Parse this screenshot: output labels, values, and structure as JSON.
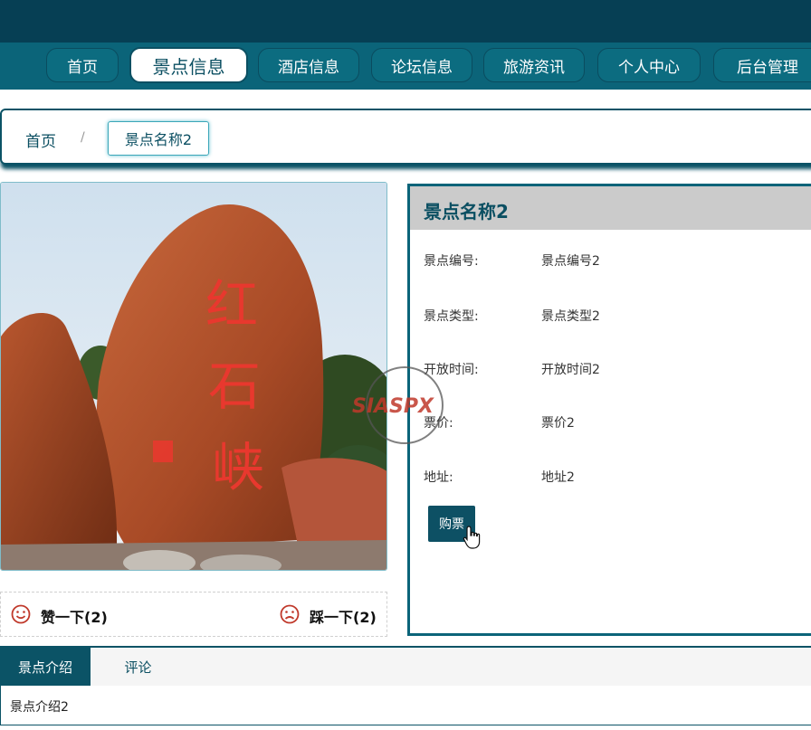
{
  "nav": {
    "items": [
      "首页",
      "景点信息",
      "酒店信息",
      "论坛信息",
      "旅游资讯",
      "个人中心",
      "后台管理"
    ],
    "active_index": 1
  },
  "breadcrumb": {
    "home": "首页",
    "separator": "/",
    "current": "景点名称2"
  },
  "photo": {
    "carved_text": "红石峡"
  },
  "vote": {
    "like_label": "赞一下(2)",
    "dislike_label": "踩一下(2)"
  },
  "info": {
    "title": "景点名称2",
    "rows": [
      {
        "label": "景点编号:",
        "value": "景点编号2"
      },
      {
        "label": "景点类型:",
        "value": "景点类型2"
      },
      {
        "label": "开放时间:",
        "value": "开放时间2"
      },
      {
        "label": "票价:",
        "value": "票价2"
      },
      {
        "label": "地址:",
        "value": "地址2"
      }
    ],
    "buy_label": "购票"
  },
  "tabs": {
    "items": [
      "景点介绍",
      "评论"
    ],
    "content": "景点介绍2"
  },
  "watermark": {
    "text": "SIASPX"
  },
  "colors": {
    "primary": "#0b5366",
    "nav_bg": "#0b6479",
    "topbar": "#063f54",
    "accent_red": "#c0392b"
  },
  "icons": {
    "like": "smile-icon",
    "dislike": "frown-icon",
    "cursor": "hand-pointer-icon"
  }
}
